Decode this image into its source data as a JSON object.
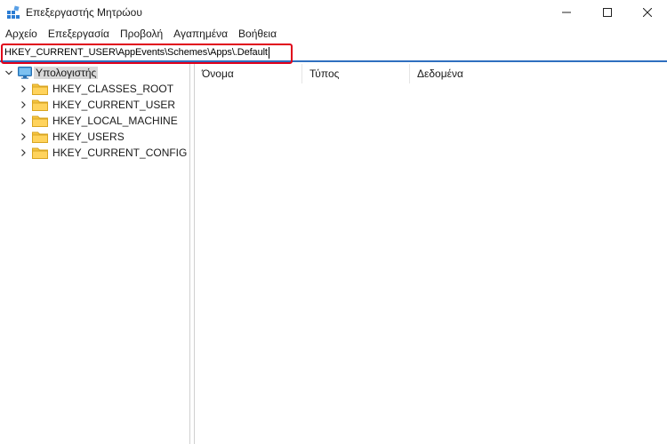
{
  "window": {
    "title": "Επεξεργαστής Μητρώου",
    "minimize_glyph": "—",
    "maximize_glyph": "☐",
    "close_glyph": "✕"
  },
  "menu": [
    "Αρχείο",
    "Επεξεργασία",
    "Προβολή",
    "Αγαπημένα",
    "Βοήθεια"
  ],
  "address": {
    "value": "HKEY_CURRENT_USER\\AppEvents\\Schemes\\Apps\\.Default"
  },
  "tree": {
    "root": {
      "label": "Υπολογιστής",
      "icon": "computer-icon",
      "expanded": true
    },
    "children": [
      {
        "label": "HKEY_CLASSES_ROOT",
        "icon": "folder-icon"
      },
      {
        "label": "HKEY_CURRENT_USER",
        "icon": "folder-icon"
      },
      {
        "label": "HKEY_LOCAL_MACHINE",
        "icon": "folder-icon"
      },
      {
        "label": "HKEY_USERS",
        "icon": "folder-icon"
      },
      {
        "label": "HKEY_CURRENT_CONFIG",
        "icon": "folder-icon"
      }
    ]
  },
  "list": {
    "columns": [
      "Όνομα",
      "Τύπος",
      "Δεδομένα"
    ]
  },
  "colors": {
    "highlight_border": "#e0001a",
    "address_underline": "#2f6fbf",
    "folder": "#f5c542",
    "selection": "#d9d9d9"
  }
}
